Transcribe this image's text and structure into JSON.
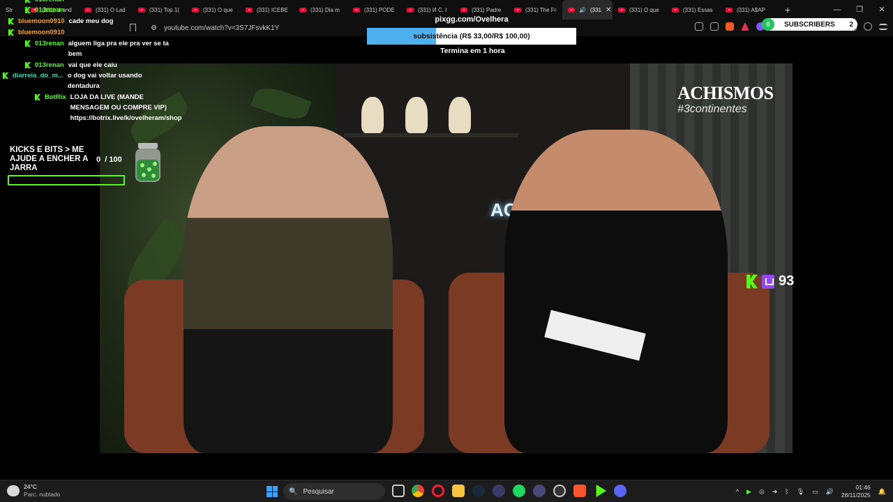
{
  "browser": {
    "tabs": [
      {
        "label": "Str"
      },
      {
        "label": "(331) Urand"
      },
      {
        "label": "(331) O Lad"
      },
      {
        "label": "(331) Top 1("
      },
      {
        "label": "(331) O que"
      },
      {
        "label": "(331) ICEBE"
      },
      {
        "label": "(331) Dia m"
      },
      {
        "label": "(331) PODE"
      },
      {
        "label": "(331) И С. I"
      },
      {
        "label": "(331) Padre"
      },
      {
        "label": "(331) The Fr"
      },
      {
        "label": "(331"
      },
      {
        "label": "(331) O que"
      },
      {
        "label": "(331) Essas"
      },
      {
        "label": "(331) A$AP"
      }
    ],
    "active_tab_index": 11,
    "new_tab_label": "+",
    "window_controls": [
      "—",
      "❐",
      "✕"
    ],
    "url": "youtube.com/watch?v=3S7JFsvkK1Y"
  },
  "chat": {
    "messages": [
      {
        "user": "013renan",
        "text": "",
        "color": "green",
        "top": 0
      },
      {
        "user": "013renan",
        "text": "",
        "color": "green"
      },
      {
        "user": "bluemoon0910",
        "text": "cade meu dog",
        "color": "orange"
      },
      {
        "user": "bluemoon0910",
        "text": "",
        "color": "orange"
      },
      {
        "user": "013renan",
        "text": "alguem liga pra ele pra ver se ta bem",
        "color": "green"
      },
      {
        "user": "013renan",
        "text": "vai que ele caiu",
        "color": "green"
      },
      {
        "user": "diarreia_do_m...",
        "text": "o dog vai voltar usando dentadura",
        "color": "cyan"
      },
      {
        "user": "BotRix",
        "text": "LOJA DA LIVE (MANDE MENSAGEM OU COMPRE VIP) https://botrix.live/k/ovelheram/shop",
        "color": "green"
      }
    ]
  },
  "jar_widget": {
    "title": "KICKS E BITS > ME AJUDE A ENCHER A JARRA",
    "current": "0",
    "goal": "/ 100",
    "progress": 0
  },
  "pix_widget": {
    "url": "pixgg.com/Ovelhera",
    "goal_text": "subsistência (R$ 33,00/R$ 100,00)",
    "progress": 0.33,
    "timer": "Termina em 1 hora"
  },
  "subscribers": {
    "left_count": "0",
    "label": "SUBSCRIBERS",
    "right_count": "2"
  },
  "video": {
    "logo": "ACHISMOS",
    "hashtag": "#3continentes",
    "neon": "ACHISMOS"
  },
  "viewers": {
    "count": "93"
  },
  "taskbar": {
    "temperature": "24°C",
    "condition": "Parc. nublado",
    "search_placeholder": "Pesquisar",
    "time": "01:46",
    "date": "28/11/2025"
  },
  "colors": {
    "kick_green": "#53fc18",
    "twitch_purple": "#9146ff",
    "pix_fill": "#4fb0f0",
    "youtube_red": "#ff0033"
  }
}
